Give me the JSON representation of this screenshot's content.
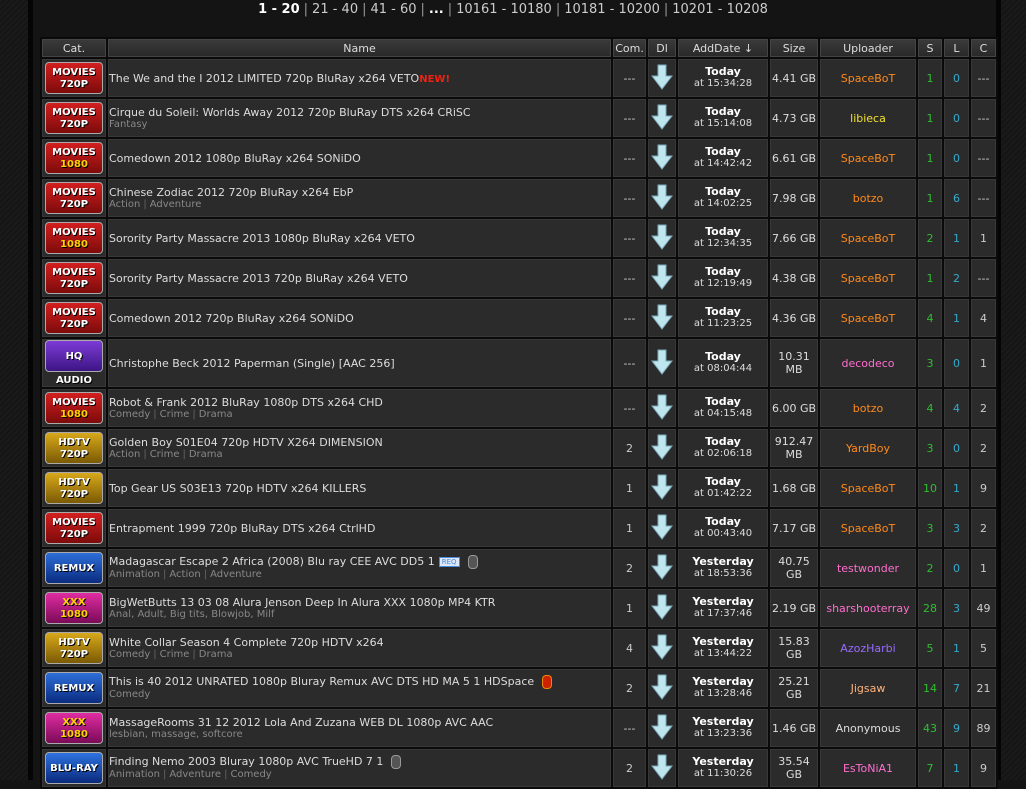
{
  "pager": {
    "current": "1 - 20",
    "pages": [
      "21 - 40",
      "41 - 60",
      "...",
      "10161 - 10180",
      "10181 - 10200",
      "10201 - 10208"
    ]
  },
  "columns": {
    "cat": "Cat.",
    "name": "Name",
    "com": "Com.",
    "dl": "Dl",
    "adddate": "AddDate ↓",
    "size": "Size",
    "uploader": "Uploader",
    "s": "S",
    "l": "L",
    "c": "C"
  },
  "colors": {
    "orange": "#ff8a1c",
    "yellow": "#f0e030",
    "pink": "#ff6fd0",
    "purple": "#9a6bff",
    "green": "#2fbf2f",
    "peach": "#ffb27a",
    "white": "#dddddd"
  },
  "rows": [
    {
      "cat1": "MOVIES",
      "cat2": "720P",
      "catType": "movies",
      "name": "The We and the I 2012 LIMITED 720p BluRay x264 VETO",
      "isNew": "NEW!",
      "genres": [],
      "com": "---",
      "day": "Today",
      "time": "at 15:34:28",
      "size": "4.41 GB",
      "uploader": "SpaceBoT",
      "uColor": "orange",
      "s": "1",
      "l": "0",
      "c": "---"
    },
    {
      "cat1": "MOVIES",
      "cat2": "720P",
      "catType": "movies",
      "name": "Cirque du Soleil: Worlds Away 2012 720p BluRay DTS x264 CRiSC",
      "genres": [
        "Fantasy"
      ],
      "com": "---",
      "day": "Today",
      "time": "at 15:14:08",
      "size": "4.73 GB",
      "uploader": "libieca",
      "uColor": "yellow",
      "s": "1",
      "l": "0",
      "c": "---"
    },
    {
      "cat1": "MOVIES",
      "cat2": "1080",
      "catType": "movies1080",
      "name": "Comedown 2012 1080p BluRay x264 SONiDO",
      "genres": [],
      "com": "---",
      "day": "Today",
      "time": "at 14:42:42",
      "size": "6.61 GB",
      "uploader": "SpaceBoT",
      "uColor": "orange",
      "s": "1",
      "l": "0",
      "c": "---"
    },
    {
      "cat1": "MOVIES",
      "cat2": "720P",
      "catType": "movies",
      "name": "Chinese Zodiac 2012 720p BluRay x264 EbP",
      "genres": [
        "Action",
        "Adventure"
      ],
      "com": "---",
      "day": "Today",
      "time": "at 14:02:25",
      "size": "7.98 GB",
      "uploader": "botzo",
      "uColor": "orange",
      "s": "1",
      "l": "6",
      "c": "---"
    },
    {
      "cat1": "MOVIES",
      "cat2": "1080",
      "catType": "movies1080",
      "name": "Sorority Party Massacre 2013 1080p BluRay x264 VETO",
      "genres": [],
      "com": "---",
      "day": "Today",
      "time": "at 12:34:35",
      "size": "7.66 GB",
      "uploader": "SpaceBoT",
      "uColor": "orange",
      "s": "2",
      "l": "1",
      "c": "1"
    },
    {
      "cat1": "MOVIES",
      "cat2": "720P",
      "catType": "movies",
      "name": "Sorority Party Massacre 2013 720p BluRay x264 VETO",
      "genres": [],
      "com": "---",
      "day": "Today",
      "time": "at 12:19:49",
      "size": "4.38 GB",
      "uploader": "SpaceBoT",
      "uColor": "orange",
      "s": "1",
      "l": "2",
      "c": "---"
    },
    {
      "cat1": "MOVIES",
      "cat2": "720P",
      "catType": "movies",
      "name": "Comedown 2012 720p BluRay x264 SONiDO",
      "genres": [],
      "com": "---",
      "day": "Today",
      "time": "at 11:23:25",
      "size": "4.36 GB",
      "uploader": "SpaceBoT",
      "uColor": "orange",
      "s": "4",
      "l": "1",
      "c": "4"
    },
    {
      "cat1": "HQ AUDIO",
      "cat2": "",
      "catType": "hq",
      "name": "Christophe Beck 2012 Paperman (Single) [AAC 256]",
      "genres": [],
      "com": "---",
      "day": "Today",
      "time": "at 08:04:44",
      "size": "10.31 MB",
      "uploader": "decodeco",
      "uColor": "pink",
      "s": "3",
      "l": "0",
      "c": "1"
    },
    {
      "cat1": "MOVIES",
      "cat2": "1080",
      "catType": "movies1080",
      "name": "Robot & Frank 2012 BluRay 1080p DTS x264 CHD",
      "genres": [
        "Comedy",
        "Crime",
        "Drama"
      ],
      "com": "---",
      "day": "Today",
      "time": "at 04:15:48",
      "size": "6.00 GB",
      "uploader": "botzo",
      "uColor": "orange",
      "s": "4",
      "l": "4",
      "c": "2"
    },
    {
      "cat1": "HDTV",
      "cat2": "720P",
      "catType": "hdtv",
      "name": "Golden Boy S01E04 720p HDTV X264 DIMENSION",
      "genres": [
        "Action",
        "Crime",
        "Drama"
      ],
      "com": "2",
      "day": "Today",
      "time": "at 02:06:18",
      "size": "912.47 MB",
      "uploader": "YardBoy",
      "uColor": "orange",
      "s": "3",
      "l": "0",
      "c": "2"
    },
    {
      "cat1": "HDTV",
      "cat2": "720P",
      "catType": "hdtv",
      "name": "Top Gear US S03E13 720p HDTV x264 KILLERS",
      "genres": [],
      "com": "1",
      "day": "Today",
      "time": "at 01:42:22",
      "size": "1.68 GB",
      "uploader": "SpaceBoT",
      "uColor": "orange",
      "s": "10",
      "l": "1",
      "c": "9"
    },
    {
      "cat1": "MOVIES",
      "cat2": "720P",
      "catType": "movies",
      "name": "Entrapment 1999 720p BluRay DTS x264 CtrlHD",
      "genres": [],
      "com": "1",
      "day": "Today",
      "time": "at 00:43:40",
      "size": "7.17 GB",
      "uploader": "SpaceBoT",
      "uColor": "orange",
      "s": "3",
      "l": "3",
      "c": "2"
    },
    {
      "cat1": "REMUX",
      "cat2": "",
      "catType": "remux",
      "name": "Madagascar Escape 2 Africa (2008) Blu ray CEE AVC DD5 1",
      "req": "REQ",
      "icon": "grey",
      "genres": [
        "Animation",
        "Action",
        "Adventure"
      ],
      "com": "2",
      "day": "Yesterday",
      "time": "at 18:53:36",
      "size": "40.75 GB",
      "uploader": "testwonder",
      "uColor": "pink",
      "s": "2",
      "l": "0",
      "c": "1"
    },
    {
      "cat1": "XXX",
      "cat2": "1080",
      "catType": "xxx",
      "name": "BigWetButts 13 03 08 Alura Jenson Deep In Alura XXX 1080p MP4 KTR",
      "genres": [
        "Anal, Adult, Big tits, Blowjob, Milf"
      ],
      "com": "1",
      "day": "Yesterday",
      "time": "at 17:37:46",
      "size": "2.19 GB",
      "uploader": "sharshooterray",
      "uColor": "pink",
      "s": "28",
      "l": "3",
      "c": "49"
    },
    {
      "cat1": "HDTV",
      "cat2": "720P",
      "catType": "hdtv",
      "name": "White Collar Season 4 Complete 720p HDTV x264",
      "genres": [
        "Comedy",
        "Crime",
        "Drama"
      ],
      "com": "4",
      "day": "Yesterday",
      "time": "at 13:44:22",
      "size": "15.83 GB",
      "uploader": "AzozHarbi",
      "uColor": "purple",
      "s": "5",
      "l": "1",
      "c": "5"
    },
    {
      "cat1": "REMUX",
      "cat2": "",
      "catType": "remux",
      "name": "This is 40 2012 UNRATED 1080p Bluray Remux AVC DTS HD MA 5 1 HDSpace",
      "icon": "red",
      "genres": [
        "Comedy"
      ],
      "com": "2",
      "day": "Yesterday",
      "time": "at 13:28:46",
      "size": "25.21 GB",
      "uploader": "Jigsaw",
      "uColor": "peach",
      "s": "14",
      "l": "7",
      "c": "21"
    },
    {
      "cat1": "XXX",
      "cat2": "1080",
      "catType": "xxx",
      "name": "MassageRooms 31 12 2012 Lola And Zuzana WEB DL 1080p AVC AAC",
      "genres": [
        "lesbian, massage, softcore"
      ],
      "com": "---",
      "day": "Yesterday",
      "time": "at 13:23:36",
      "size": "1.46 GB",
      "uploader": "Anonymous",
      "uColor": "white",
      "s": "43",
      "l": "9",
      "c": "89"
    },
    {
      "cat1": "BLU-RAY",
      "cat2": "",
      "catType": "bluray",
      "name": "Finding Nemo 2003 Bluray 1080p AVC TrueHD 7 1",
      "icon": "grey",
      "genres": [
        "Animation",
        "Adventure",
        "Comedy"
      ],
      "com": "2",
      "day": "Yesterday",
      "time": "at 11:30:26",
      "size": "35.54 GB",
      "uploader": "EsToNiA1",
      "uColor": "pink",
      "s": "7",
      "l": "1",
      "c": "9"
    }
  ]
}
